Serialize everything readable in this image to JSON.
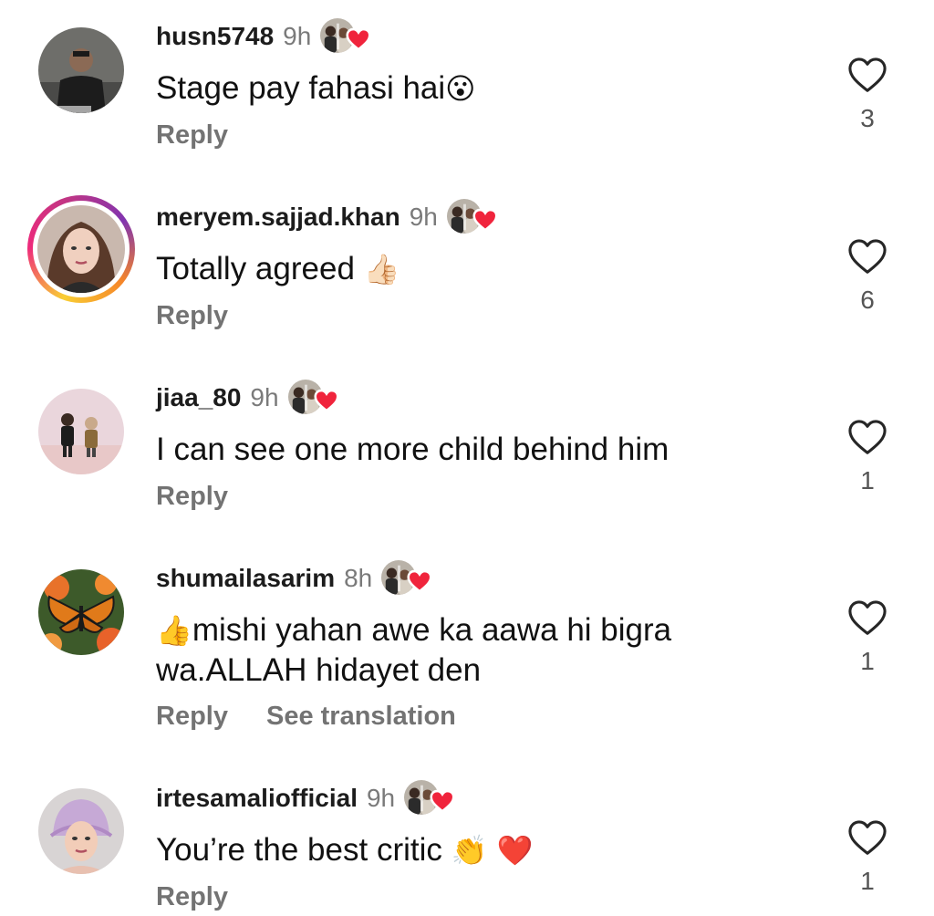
{
  "comments": [
    {
      "username": "husn5748",
      "time": "9h",
      "text": "Stage pay fahasi hai",
      "emoji": "😮",
      "reply_label": "Reply",
      "likes": "3"
    },
    {
      "username": "meryem.sajjad.khan",
      "time": "9h",
      "text": "Totally agreed",
      "emoji": "👍🏻",
      "reply_label": "Reply",
      "likes": "6"
    },
    {
      "username": "jiaa_80",
      "time": "9h",
      "text": "I can see one more child behind him",
      "reply_label": "Reply",
      "likes": "1"
    },
    {
      "username": "shumailasarim",
      "time": "8h",
      "emoji_prefix": "👍",
      "text_line1": "mishi yahan awe ka aawa hi bigra",
      "text_line2": "wa.ALLAH hidayet den",
      "reply_label": "Reply",
      "translate_label": "See translation",
      "likes": "1"
    },
    {
      "username": "irtesamaliofficial",
      "time": "9h",
      "text": "You’re the best critic",
      "emoji": "👏 ❤️",
      "reply_label": "Reply",
      "likes": "1"
    }
  ],
  "colors": {
    "username": "#1c1c1c",
    "secondary_text": "#737373",
    "heart_red": "#f0243c",
    "like_outline": "#262626"
  },
  "icons": {
    "like": "heart-outline-icon",
    "creator_liked": "creator-liked-heart-icon"
  }
}
